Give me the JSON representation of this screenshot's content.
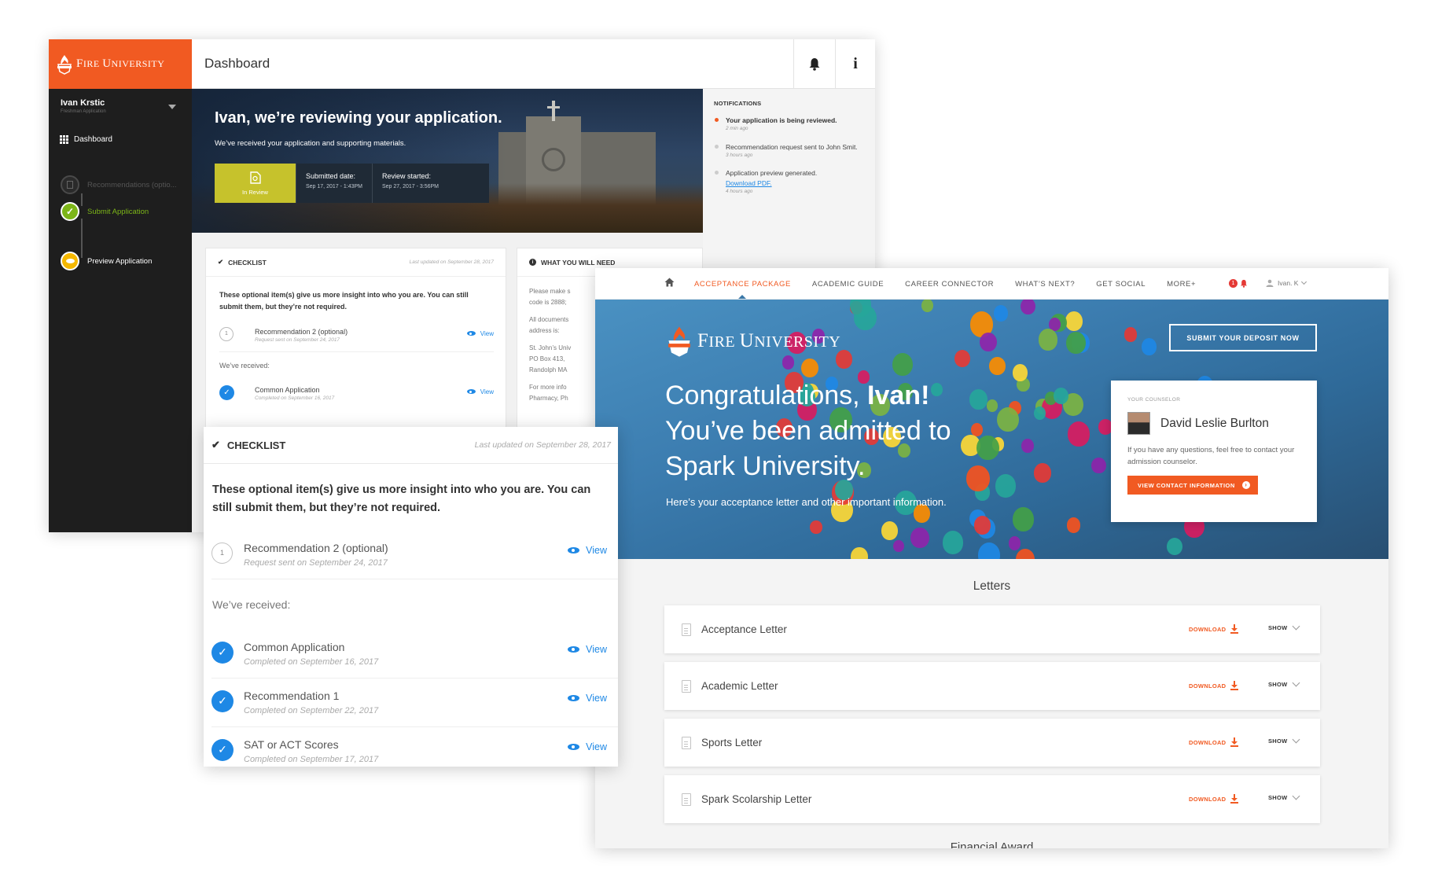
{
  "dashboard": {
    "brand": "Fire University",
    "page_title": "Dashboard",
    "user": {
      "name": "Ivan Krstic",
      "sub": "Freshman Application"
    },
    "nav": {
      "dashboard": "Dashboard"
    },
    "steps": [
      {
        "label": "Recommendations (optio...",
        "state": "disabled"
      },
      {
        "label": "Submit Application",
        "state": "done"
      },
      {
        "label": "Preview Application",
        "state": "current"
      }
    ],
    "hero": {
      "title": "Ivan, we’re reviewing your application.",
      "subtitle": "We’ve received your application and supporting materials.",
      "status_label": "In Review",
      "submitted_label": "Submitted date:",
      "submitted_value": "Sep 17, 2017 - 1:43PM",
      "review_label": "Review started:",
      "review_value": "Sep 27, 2017 - 3:56PM"
    },
    "notifications": {
      "heading": "NOTIFICATIONS",
      "items": [
        {
          "text": "Your application is being reviewed.",
          "time": "2 min ago",
          "unread": true
        },
        {
          "text": "Recommendation request sent to John Smit.",
          "time": "3 hours ago",
          "unread": false
        },
        {
          "text": "Application preview generated.",
          "link": "Download PDF.",
          "time": "4 hours ago",
          "unread": false
        }
      ]
    },
    "checklist": {
      "heading": "CHECKLIST",
      "updated": "Last updated on September 28, 2017",
      "intro": "These optional item(s) give us more insight into who you are. You can still submit them, but they’re not required.",
      "optional": {
        "num": "1",
        "title": "Recommendation 2 (optional)",
        "sub": "Request sent on September 24, 2017"
      },
      "received_label": "We’ve received:",
      "received": [
        {
          "title": "Common Application",
          "sub": "Completed on September 16, 2017"
        }
      ],
      "view": "View"
    },
    "need": {
      "heading": "WHAT YOU WILL NEED",
      "lines": [
        "Please make s",
        "code is 2888;",
        "",
        "All documents",
        "address is:",
        "",
        "St. John’s Univ",
        "PO Box 413,",
        "Randolph MA",
        "",
        "For more info",
        "Pharmacy, Ph"
      ]
    }
  },
  "checklist_large": {
    "heading": "CHECKLIST",
    "updated": "Last updated on September 28, 2017",
    "intro": "These optional item(s) give us more insight into who you are. You can still submit them, but they’re not required.",
    "optional": {
      "num": "1",
      "title": "Recommendation 2 (optional)",
      "sub": "Request sent on September 24, 2017"
    },
    "received_label": "We’ve received:",
    "received": [
      {
        "title": "Common Application",
        "sub": "Completed on September 16, 2017"
      },
      {
        "title": "Recommendation 1",
        "sub": "Completed on September 22, 2017"
      },
      {
        "title": "SAT or ACT Scores",
        "sub": "Completed on September 17, 2017"
      }
    ],
    "view": "View"
  },
  "acceptance": {
    "nav": {
      "items": [
        "ACCEPTANCE PACKAGE",
        "ACADEMIC GUIDE",
        "CAREER CONNECTOR",
        "WHAT’S NEXT?",
        "GET SOCIAL",
        "MORE+"
      ],
      "badge": "1",
      "user": "Ivan. K"
    },
    "brand": "Fire University",
    "hero": {
      "title_pre": "Congratulations, ",
      "title_name": "Ivan!",
      "title_rest": "You’ve been admitted to Spark University.",
      "subtitle": "Here’s your acceptance letter and other important information.",
      "deposit": "SUBMIT YOUR DEPOSIT NOW"
    },
    "counselor": {
      "label": "YOUR COUNSELOR",
      "name": "David Leslie Burlton",
      "text": "If you have any questions, feel free to contact your admission counselor.",
      "button": "VIEW CONTACT INFORMATION"
    },
    "letters_heading": "Letters",
    "letters": [
      "Acceptance Letter",
      "Academic Letter",
      "Sports Letter",
      "Spark Scolarship Letter"
    ],
    "download": "DOWNLOAD",
    "show": "SHOW",
    "next_section": "Financial Award"
  },
  "colors": {
    "brand_orange": "#f15a22",
    "link_blue": "#1e88e5",
    "review_yellow": "#c6c22c",
    "done_green": "#7cb518",
    "current_yellow": "#f5b800"
  }
}
